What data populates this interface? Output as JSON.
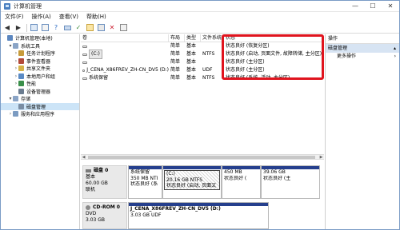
{
  "window": {
    "title": "计算机管理",
    "btn_min": "—",
    "btn_max": "☐",
    "btn_close": "✕"
  },
  "menu": [
    "文件(F)",
    "操作(A)",
    "查看(V)",
    "帮助(H)"
  ],
  "toolbar": {
    "icons": [
      "back-arrow-icon",
      "forward-arrow-icon",
      "console-tree-icon",
      "properties-icon",
      "help-icon",
      "disk-icon",
      "check-icon",
      "grid-icon",
      "list-icon",
      "delete-icon",
      "settings-icon"
    ]
  },
  "tree": {
    "items": [
      {
        "label": "计算机管理(本地)",
        "level": 0,
        "twisty": "",
        "icon": "#5b86bf"
      },
      {
        "label": "系统工具",
        "level": 1,
        "twisty": "▾",
        "icon": "#8aa4c6"
      },
      {
        "label": "任务计划程序",
        "level": 2,
        "twisty": "›",
        "icon": "#c79b3b"
      },
      {
        "label": "事件查看器",
        "level": 2,
        "twisty": "›",
        "icon": "#b24a3a"
      },
      {
        "label": "共享文件夹",
        "level": 2,
        "twisty": "›",
        "icon": "#d6b347"
      },
      {
        "label": "本地用户和组",
        "level": 2,
        "twisty": "›",
        "icon": "#5a8ac4"
      },
      {
        "label": "性能",
        "level": 2,
        "twisty": "›",
        "icon": "#3a8f4a"
      },
      {
        "label": "设备管理器",
        "level": 2,
        "twisty": "",
        "icon": "#6b7c8f"
      },
      {
        "label": "存储",
        "level": 1,
        "twisty": "▾",
        "icon": "#8aa4c6"
      },
      {
        "label": "磁盘管理",
        "level": 2,
        "twisty": "",
        "icon": "#7a8da3",
        "selected": true
      },
      {
        "label": "服务和应用程序",
        "level": 1,
        "twisty": "›",
        "icon": "#7b9bc1"
      }
    ]
  },
  "volumes": {
    "headers": [
      "卷",
      "布局",
      "类型",
      "文件系统",
      "状态"
    ],
    "rows": [
      {
        "name": "",
        "layout": "简单",
        "type": "基本",
        "fs": "",
        "status": "状态良好 (恢复分区)",
        "chip": false
      },
      {
        "name": "(C:)",
        "layout": "简单",
        "type": "基本",
        "fs": "NTFS",
        "status": "状态良好 (启动, 页面文件, 故障转储, 主分区)",
        "chip": true
      },
      {
        "name": "",
        "layout": "简单",
        "type": "基本",
        "fs": "",
        "status": "状态良好 (主分区)",
        "chip": false
      },
      {
        "name": "J_CENA_X86FREV_ZH-CN_DV5 (D:)",
        "layout": "简单",
        "type": "基本",
        "fs": "UDF",
        "status": "状态良好 (主分区)",
        "chip": false
      },
      {
        "name": "系统保留",
        "layout": "简单",
        "type": "基本",
        "fs": "NTFS",
        "status": "状态良好 (系统, 活动, 主分区)",
        "chip": false
      }
    ]
  },
  "disk0": {
    "title": "磁盘 0",
    "kind": "基本",
    "size": "60.00 GB",
    "state": "联机",
    "partitions": [
      {
        "name": "系统保留",
        "size": "350 MB NTI",
        "status": "状态良好 (系",
        "hatched": false
      },
      {
        "name": "(C:)",
        "size": "20.16 GB NTFS",
        "status": "状态良好 (启动, 页面文",
        "hatched": true
      },
      {
        "name": "",
        "size": "450 MB",
        "status": "状态良好 (",
        "hatched": false
      },
      {
        "name": "",
        "size": "39.06 GB",
        "status": "状态良好 (主",
        "hatched": false
      }
    ]
  },
  "cdrom0": {
    "title": "CD-ROM 0",
    "kind": "DVD",
    "size": "3.03 GB",
    "partition": {
      "name": "J_CENA_X86FREV_ZH-CN_DV5 (D:)",
      "size": "3.03 GB UDF"
    }
  },
  "actions": {
    "header": "操作",
    "section": "磁盘管理",
    "section_arrow": "▴",
    "more": "更多操作",
    "more_arrow": "›"
  }
}
